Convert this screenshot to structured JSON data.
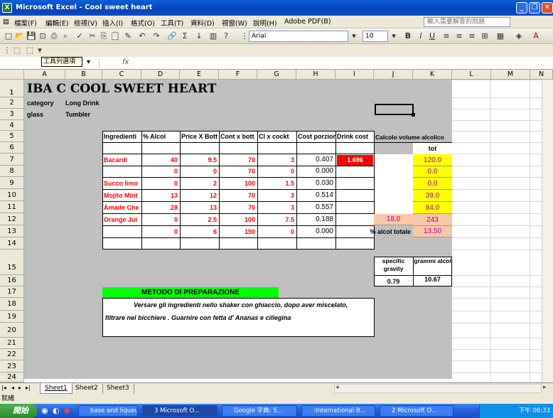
{
  "window": {
    "title": "Microsoft Excel - Cool sweet heart",
    "app_icon": "excel-icon"
  },
  "menu": {
    "items": [
      "檔案(F)",
      "編輯(E)",
      "檢視(V)",
      "插入(I)",
      "格式(O)",
      "工具(T)",
      "資料(D)",
      "視窗(W)",
      "說明(H)",
      "Adobe PDF(B)"
    ],
    "help_placeholder": "輸入需要解答的問題"
  },
  "toolbar": {
    "font_name": "Arial",
    "font_size": "10",
    "tooltip": "工具列選項",
    "fx": "fx"
  },
  "sheet": {
    "columns": [
      "A",
      "B",
      "C",
      "D",
      "E",
      "F",
      "G",
      "H",
      "I",
      "J",
      "K",
      "L",
      "M",
      "N"
    ],
    "rows": [
      "1",
      "2",
      "3",
      "4",
      "5",
      "6",
      "7",
      "8",
      "9",
      "10",
      "11",
      "12",
      "13",
      "14",
      "15",
      "16",
      "17",
      "18",
      "19",
      "20",
      "21",
      "22",
      "23",
      "24"
    ],
    "title": "IBA C COOL SWEET HEART",
    "category_label": "category",
    "category_value": "Long Drink",
    "glass_label": "glass",
    "glass_value": "Tumbler",
    "table_headers": [
      "Ingredienti",
      "% Alcol",
      "Price X Bott",
      "Cont x bott",
      "Cl x cockt",
      "Cost porzion",
      "Drink cost"
    ],
    "ingredients": [
      {
        "name": "Bacardi",
        "alcol": "40",
        "price": "9.5",
        "cont": "70",
        "cl": "3",
        "cost": "0.407"
      },
      {
        "name": "",
        "alcol": "0",
        "price": "0",
        "cont": "70",
        "cl": "0",
        "cost": "0.000"
      },
      {
        "name": "Succo limo",
        "alcol": "0",
        "price": "2",
        "cont": "100",
        "cl": "1.5",
        "cost": "0.030"
      },
      {
        "name": "Mojito Mint",
        "alcol": "13",
        "price": "12",
        "cont": "70",
        "cl": "3",
        "cost": "0.514"
      },
      {
        "name": "Amade Che",
        "alcol": "28",
        "price": "13",
        "cont": "70",
        "cl": "3",
        "cost": "0.557"
      },
      {
        "name": "Orange Jui",
        "alcol": "0",
        "price": "2.5",
        "cont": "100",
        "cl": "7.5",
        "cost": "0.188"
      },
      {
        "name": "",
        "alcol": "0",
        "price": "6",
        "cont": "150",
        "cl": "0",
        "cost": "0.000"
      }
    ],
    "drink_cost": "1.696",
    "calc_title": "Calcolo volume alcolico",
    "tot_label": "tot",
    "tot_values": [
      "120.0",
      "0.0",
      "0.0",
      "39.0",
      "84.0",
      "243"
    ],
    "j12_value": "18.0",
    "alcol_totale_label": "% alcol totale",
    "alcol_totale_value": "13.50",
    "specific_gravity_label": "specific gravity",
    "specific_gravity_value": "0.79",
    "grammi_alcol_label": "grammi alcol",
    "grammi_alcol_value": "10.67",
    "metodo_title": "METODO DI PREPARAZIONE",
    "metodo_line1": "Versare gli ingredienti nello shaker con ghiaccio, dopo aver miscelato,",
    "metodo_line2": "filtrare nel bicchiere . Guarnire con fetta d' Ananas e ciliegina"
  },
  "tabs": [
    "Sheet1",
    "Sheet2",
    "Sheet3"
  ],
  "status": "就緒",
  "taskbar": {
    "start": "開始",
    "tasks": [
      "base and liqueur",
      "3 Microsoft O...",
      "Google 字典: S...",
      ":International B...",
      "2 Microsoft O..."
    ],
    "clock": "下午 06:33"
  },
  "colors": {
    "title_bar": "#0842b5",
    "sheet_gray": "#c0c0c0",
    "green_header": "#00ff00",
    "red_fill": "#ff0000",
    "yellow_fill": "#ffff00",
    "peach_fill": "#f8c8a6",
    "value_red": "#ff0000"
  }
}
